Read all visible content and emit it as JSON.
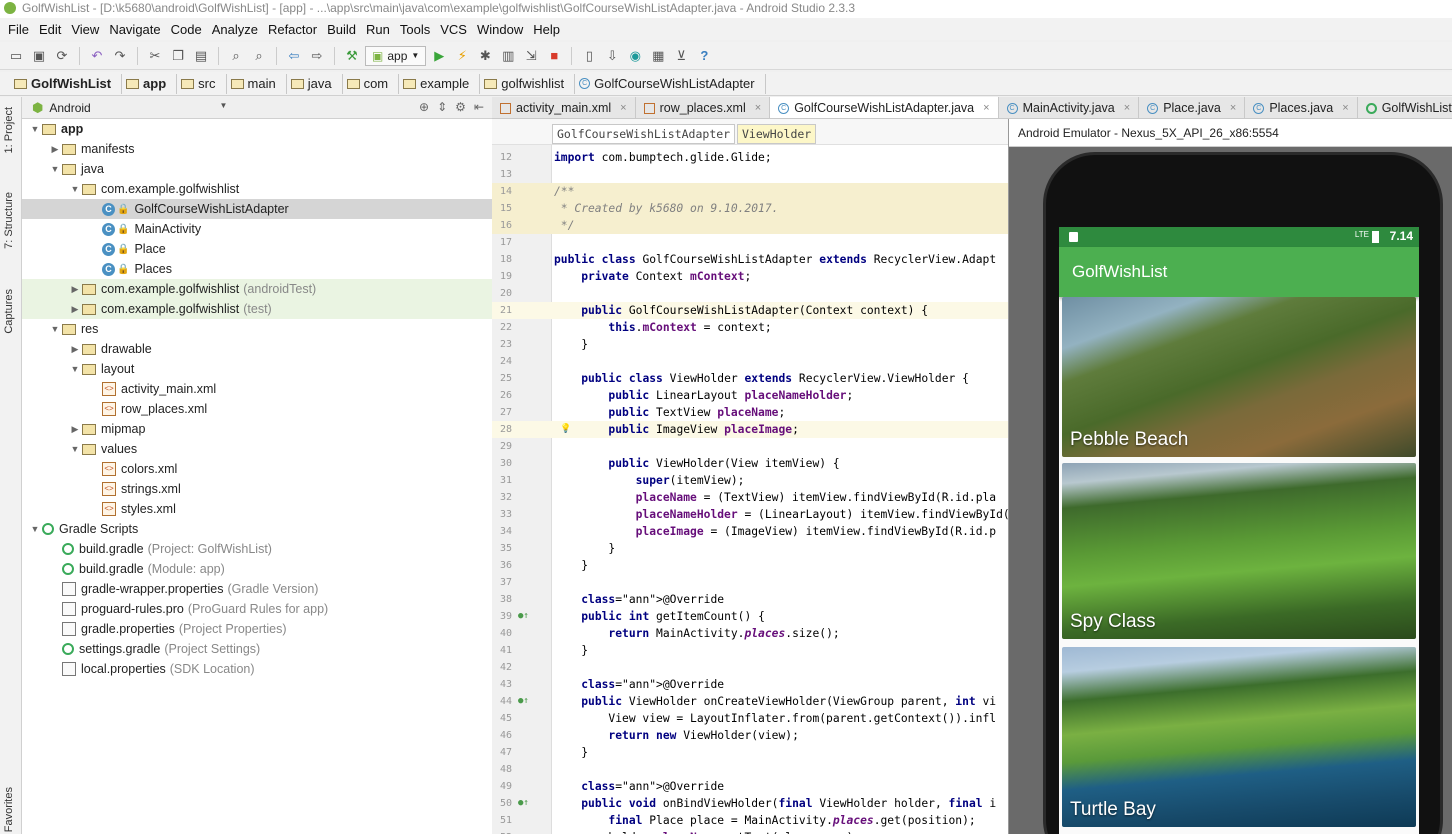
{
  "window": {
    "title": "GolfWishList - [D:\\k5680\\android\\GolfWishList] - [app] - ...\\app\\src\\main\\java\\com\\example\\golfwishlist\\GolfCourseWishListAdapter.java - Android Studio 2.3.3"
  },
  "menu": [
    "File",
    "Edit",
    "View",
    "Navigate",
    "Code",
    "Analyze",
    "Refactor",
    "Build",
    "Run",
    "Tools",
    "VCS",
    "Window",
    "Help"
  ],
  "toolbar": {
    "run_config": "app"
  },
  "breadcrumb": [
    "GolfWishList",
    "app",
    "src",
    "main",
    "java",
    "com",
    "example",
    "golfwishlist",
    "GolfCourseWishListAdapter"
  ],
  "side_tabs": [
    "1: Project",
    "7: Structure",
    "Captures",
    "Favorites"
  ],
  "project": {
    "view_mode": "Android",
    "tree": [
      {
        "label": "app",
        "suffix": "",
        "depth": 0,
        "icon": "folder-icon",
        "expanded": true,
        "bold": true
      },
      {
        "label": "manifests",
        "suffix": "",
        "depth": 1,
        "icon": "folder-icon",
        "expanded": false
      },
      {
        "label": "java",
        "suffix": "",
        "depth": 1,
        "icon": "folder-icon",
        "expanded": true
      },
      {
        "label": "com.example.golfwishlist",
        "suffix": "",
        "depth": 2,
        "icon": "package-icon",
        "expanded": true
      },
      {
        "label": "GolfCourseWishListAdapter",
        "suffix": "",
        "depth": 3,
        "icon": "class-icon",
        "selected": true
      },
      {
        "label": "MainActivity",
        "suffix": "",
        "depth": 3,
        "icon": "class-icon"
      },
      {
        "label": "Place",
        "suffix": "",
        "depth": 3,
        "icon": "class-icon"
      },
      {
        "label": "Places",
        "suffix": "",
        "depth": 3,
        "icon": "class-icon"
      },
      {
        "label": "com.example.golfwishlist",
        "suffix": "(androidTest)",
        "depth": 2,
        "icon": "package-icon",
        "expanded": false,
        "test": true
      },
      {
        "label": "com.example.golfwishlist",
        "suffix": "(test)",
        "depth": 2,
        "icon": "package-icon",
        "expanded": false,
        "test": true
      },
      {
        "label": "res",
        "suffix": "",
        "depth": 1,
        "icon": "folder-icon",
        "expanded": true
      },
      {
        "label": "drawable",
        "suffix": "",
        "depth": 2,
        "icon": "folder-icon",
        "expanded": false
      },
      {
        "label": "layout",
        "suffix": "",
        "depth": 2,
        "icon": "folder-icon",
        "expanded": true
      },
      {
        "label": "activity_main.xml",
        "suffix": "",
        "depth": 3,
        "icon": "xml-icon"
      },
      {
        "label": "row_places.xml",
        "suffix": "",
        "depth": 3,
        "icon": "xml-icon"
      },
      {
        "label": "mipmap",
        "suffix": "",
        "depth": 2,
        "icon": "folder-icon",
        "expanded": false
      },
      {
        "label": "values",
        "suffix": "",
        "depth": 2,
        "icon": "folder-icon",
        "expanded": true
      },
      {
        "label": "colors.xml",
        "suffix": "",
        "depth": 3,
        "icon": "xml-icon"
      },
      {
        "label": "strings.xml",
        "suffix": "",
        "depth": 3,
        "icon": "xml-icon"
      },
      {
        "label": "styles.xml",
        "suffix": "",
        "depth": 3,
        "icon": "xml-icon"
      },
      {
        "label": "Gradle Scripts",
        "suffix": "",
        "depth": 0,
        "icon": "gradle-icon",
        "expanded": true
      },
      {
        "label": "build.gradle",
        "suffix": "(Project: GolfWishList)",
        "depth": 1,
        "icon": "gradle-icon"
      },
      {
        "label": "build.gradle",
        "suffix": "(Module: app)",
        "depth": 1,
        "icon": "gradle-icon"
      },
      {
        "label": "gradle-wrapper.properties",
        "suffix": "(Gradle Version)",
        "depth": 1,
        "icon": "properties-icon"
      },
      {
        "label": "proguard-rules.pro",
        "suffix": "(ProGuard Rules for app)",
        "depth": 1,
        "icon": "file-icon"
      },
      {
        "label": "gradle.properties",
        "suffix": "(Project Properties)",
        "depth": 1,
        "icon": "properties-icon"
      },
      {
        "label": "settings.gradle",
        "suffix": "(Project Settings)",
        "depth": 1,
        "icon": "gradle-icon"
      },
      {
        "label": "local.properties",
        "suffix": "(SDK Location)",
        "depth": 1,
        "icon": "properties-icon"
      }
    ]
  },
  "editor_tabs": [
    {
      "label": "activity_main.xml",
      "icon": "xml-icon"
    },
    {
      "label": "row_places.xml",
      "icon": "xml-icon"
    },
    {
      "label": "GolfCourseWishListAdapter.java",
      "icon": "class-icon",
      "active": true
    },
    {
      "label": "MainActivity.java",
      "icon": "class-icon"
    },
    {
      "label": "Place.java",
      "icon": "class-icon"
    },
    {
      "label": "Places.java",
      "icon": "class-icon"
    },
    {
      "label": "GolfWishList",
      "icon": "gradle-icon"
    }
  ],
  "nav": {
    "class": "GolfCourseWishListAdapter",
    "inner": "ViewHolder"
  },
  "code": [
    {
      "n": "12",
      "t": "import com.bumptech.glide.Glide;"
    },
    {
      "n": "13",
      "t": ""
    },
    {
      "n": "14",
      "t": "/**",
      "cls": "cm",
      "bg": "comment"
    },
    {
      "n": "15",
      "t": " * Created by k5680 on 9.10.2017.",
      "cls": "cm",
      "bg": "comment"
    },
    {
      "n": "16",
      "t": " */",
      "cls": "cm",
      "bg": "comment"
    },
    {
      "n": "17",
      "t": ""
    },
    {
      "n": "18",
      "t": "public class GolfCourseWishListAdapter extends RecyclerView.Adapt"
    },
    {
      "n": "19",
      "t": "    private Context mContext;"
    },
    {
      "n": "20",
      "t": ""
    },
    {
      "n": "21",
      "t": "    public GolfCourseWishListAdapter(Context context) {",
      "bg": "hl"
    },
    {
      "n": "22",
      "t": "        this.mContext = context;"
    },
    {
      "n": "23",
      "t": "    }"
    },
    {
      "n": "24",
      "t": ""
    },
    {
      "n": "25",
      "t": "    public class ViewHolder extends RecyclerView.ViewHolder {"
    },
    {
      "n": "26",
      "t": "        public LinearLayout placeNameHolder;"
    },
    {
      "n": "27",
      "t": "        public TextView placeName;"
    },
    {
      "n": "28",
      "t": "        public ImageView placeImage;",
      "bg": "hl",
      "bulb": true
    },
    {
      "n": "29",
      "t": ""
    },
    {
      "n": "30",
      "t": "        public ViewHolder(View itemView) {"
    },
    {
      "n": "31",
      "t": "            super(itemView);"
    },
    {
      "n": "32",
      "t": "            placeName = (TextView) itemView.findViewById(R.id.pla"
    },
    {
      "n": "33",
      "t": "            placeNameHolder = (LinearLayout) itemView.findViewById("
    },
    {
      "n": "34",
      "t": "            placeImage = (ImageView) itemView.findViewById(R.id.p"
    },
    {
      "n": "35",
      "t": "        }"
    },
    {
      "n": "36",
      "t": "    }"
    },
    {
      "n": "37",
      "t": ""
    },
    {
      "n": "38",
      "t": "    @Override"
    },
    {
      "n": "39",
      "t": "    public int getItemCount() {",
      "mark": true
    },
    {
      "n": "40",
      "t": "        return MainActivity.places.size();"
    },
    {
      "n": "41",
      "t": "    }"
    },
    {
      "n": "42",
      "t": ""
    },
    {
      "n": "43",
      "t": "    @Override"
    },
    {
      "n": "44",
      "t": "    public ViewHolder onCreateViewHolder(ViewGroup parent, int vi",
      "mark": true
    },
    {
      "n": "45",
      "t": "        View view = LayoutInflater.from(parent.getContext()).infl"
    },
    {
      "n": "46",
      "t": "        return new ViewHolder(view);"
    },
    {
      "n": "47",
      "t": "    }"
    },
    {
      "n": "48",
      "t": ""
    },
    {
      "n": "49",
      "t": "    @Override"
    },
    {
      "n": "50",
      "t": "    public void onBindViewHolder(final ViewHolder holder, final i",
      "mark": true
    },
    {
      "n": "51",
      "t": "        final Place place = MainActivity.places.get(position);"
    },
    {
      "n": "52",
      "t": "        holder.placeName.setText(place.name);"
    }
  ],
  "emulator": {
    "title": "Android Emulator - Nexus_5X_API_26_x86:5554",
    "status_time": "7.14",
    "status_net": "LTE",
    "app_title": "GolfWishList",
    "cards": [
      "Pebble Beach",
      "Spy Class",
      "Turtle Bay"
    ]
  },
  "colors": {
    "accent": "#4caf50",
    "status": "#2e8a3e"
  }
}
